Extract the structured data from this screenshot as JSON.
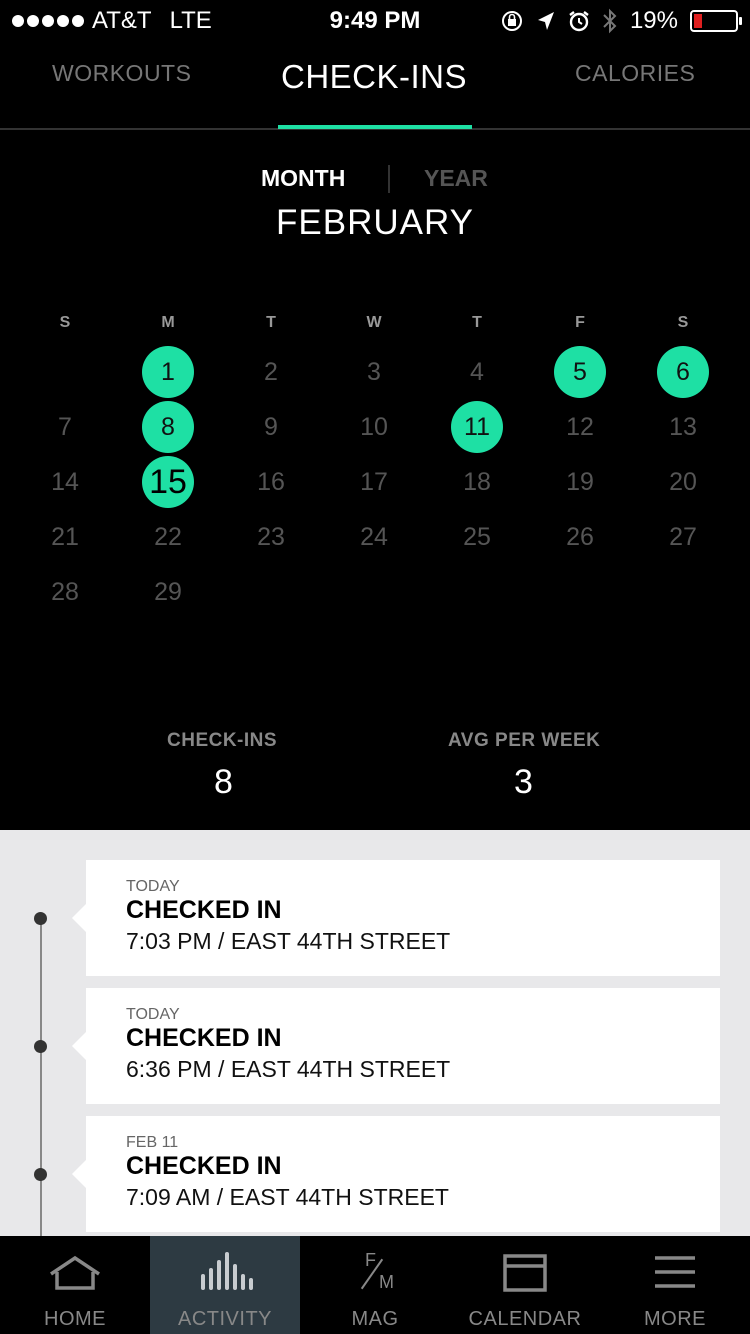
{
  "status_bar": {
    "carrier": "AT&T",
    "network": "LTE",
    "time": "9:49 PM",
    "battery_percent": "19%",
    "battery_level": 0.19,
    "icons": [
      "orientation-lock-icon",
      "location-icon",
      "alarm-icon",
      "bluetooth-icon"
    ]
  },
  "tabs": [
    {
      "label": "WORKOUTS",
      "active": false
    },
    {
      "label": "CHECK-INS",
      "active": true
    },
    {
      "label": "CALORIES",
      "active": false
    }
  ],
  "period_toggle": {
    "month_label": "MONTH",
    "year_label": "YEAR",
    "selected": "MONTH"
  },
  "calendar": {
    "month_title": "FEBRUARY",
    "weekdays": [
      "S",
      "M",
      "T",
      "W",
      "T",
      "F",
      "S"
    ],
    "first_weekday_index": 1,
    "days_in_month": 29,
    "checked_in_days": [
      1,
      5,
      6,
      8,
      11,
      15
    ],
    "today": 15,
    "accent_color": "#1ee0a4"
  },
  "stats": {
    "checkins_label": "CHECK-INS",
    "checkins_value": "8",
    "avg_label": "AVG PER WEEK",
    "avg_value": "3"
  },
  "timeline": [
    {
      "when": "TODAY",
      "title": "CHECKED IN",
      "detail": "7:03 PM / EAST 44TH STREET"
    },
    {
      "when": "TODAY",
      "title": "CHECKED IN",
      "detail": "6:36 PM / EAST 44TH STREET"
    },
    {
      "when": "FEB 11",
      "title": "CHECKED IN",
      "detail": "7:09 AM / EAST 44TH STREET"
    }
  ],
  "bottom_nav": [
    {
      "label": "HOME",
      "icon": "home-icon",
      "active": false
    },
    {
      "label": "ACTIVITY",
      "icon": "activity-bars-icon",
      "active": true
    },
    {
      "label": "MAG",
      "icon": "mag-fm-icon",
      "active": false
    },
    {
      "label": "CALENDAR",
      "icon": "calendar-icon",
      "active": false
    },
    {
      "label": "MORE",
      "icon": "menu-icon",
      "active": false
    }
  ],
  "mag_icon_letters": {
    "top": "F",
    "bottom": "M"
  }
}
